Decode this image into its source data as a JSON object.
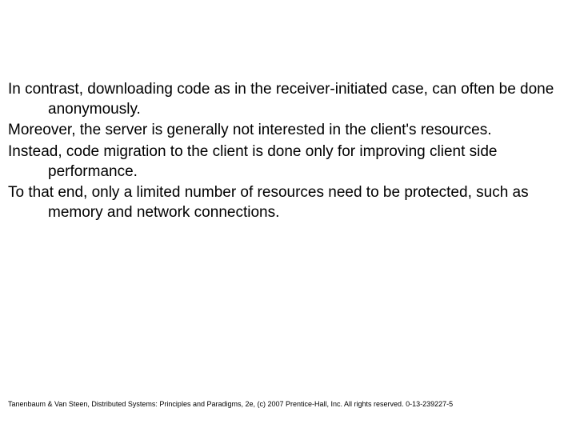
{
  "body": {
    "p1": "In contrast, downloading code as in the receiver-initiated case, can often be done anonymously.",
    "p2": " Moreover, the server is generally not interested in the client's resources.",
    "p3": "Instead, code migration to the client is done only for improving client side performance.",
    "p4": "To that end, only a limited number of resources need to be protected, such as memory and network connections."
  },
  "footer": {
    "text": "Tanenbaum & Van Steen, Distributed Systems: Principles and Paradigms, 2e, (c) 2007 Prentice-Hall, Inc. All rights reserved. 0-13-239227-5"
  }
}
